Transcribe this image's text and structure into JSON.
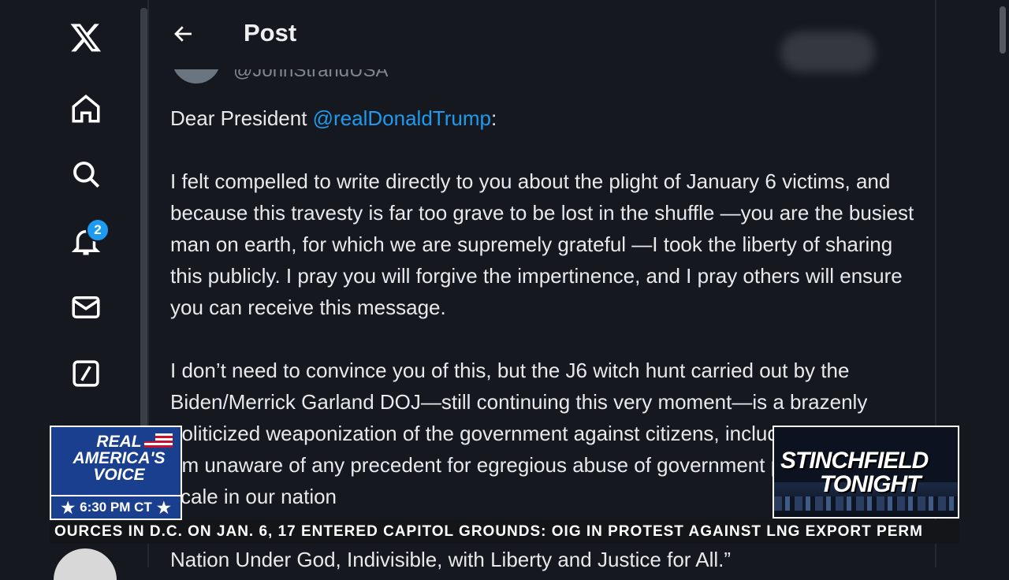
{
  "header": {
    "title": "Post"
  },
  "nav": {
    "notifications_badge": "2"
  },
  "author": {
    "handle": "@JohnStrandUSA"
  },
  "post": {
    "greeting_prefix": "Dear President ",
    "mention": "@realDonaldTrump",
    "greeting_suffix": ":",
    "para1": "I felt compelled to write directly to you about the plight of January 6 victims, and because this travesty is far too grave to be lost in the shuffle —you are the busiest man on earth, for which we are supremely grateful —I took the liberty of sharing this publicly. I pray you will forgive the impertinence, and I pray others will ensure you can receive this message.",
    "para2": "I don’t need to convince you of this, but the J6 witch hunt carried out by the Biden/Merrick Garland DOJ—still continuing this very moment—is a brazenly politicized weaponization of the government against citizens, including yourself. I am unaware of any precedent for egregious abuse of government power at this scale in our nation",
    "last_line": "Nation Under God, Indivisible, with Liberty and Justice for All.”"
  },
  "overlay": {
    "network_line1": "REAL",
    "network_line2": "AMERICA'S",
    "network_line3": "VOICE",
    "time": "6:30 PM CT",
    "show_line1": "STINCHFIELD",
    "show_line2": "TONIGHT",
    "ticker": "OURCES IN D.C. ON JAN. 6, 17  ENTERED CAPITOL GROUNDS: OIG      IN PROTEST AGAINST LNG EXPORT PERM"
  }
}
